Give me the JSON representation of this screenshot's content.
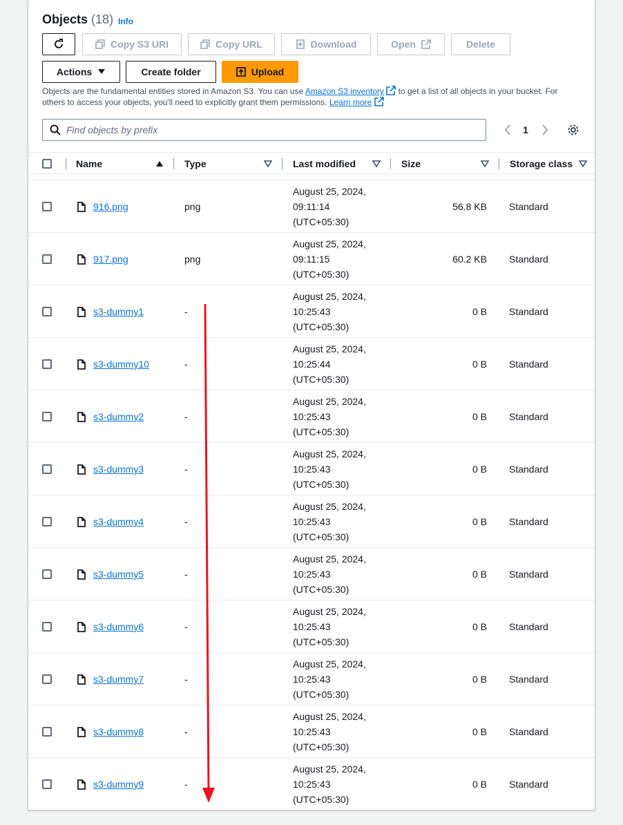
{
  "header": {
    "title": "Objects",
    "count": "(18)",
    "info": "Info"
  },
  "toolbar": {
    "refresh": "refresh",
    "copy_s3_uri": "Copy S3 URI",
    "copy_url": "Copy URL",
    "download": "Download",
    "open": "Open",
    "delete": "Delete",
    "actions": "Actions",
    "create_folder": "Create folder",
    "upload": "Upload"
  },
  "description": {
    "part1": "Objects are the fundamental entities stored in Amazon S3. You can use ",
    "link1": "Amazon S3 inventory",
    "part2": " to get a list of all objects in your bucket. For others to access your objects, you'll need to explicitly grant them permissions. ",
    "link2": "Learn more"
  },
  "search": {
    "placeholder": "Find objects by prefix"
  },
  "pagination": {
    "page": "1"
  },
  "table": {
    "columns": [
      "Name",
      "Type",
      "Last modified",
      "Size",
      "Storage class"
    ],
    "rows": [
      {
        "name": "916.png",
        "type": "png",
        "date": "August 25, 2024,",
        "time": "09:11:14",
        "tz": "(UTC+05:30)",
        "size": "56.8 KB",
        "class": "Standard"
      },
      {
        "name": "917.png",
        "type": "png",
        "date": "August 25, 2024,",
        "time": "09:11:15",
        "tz": "(UTC+05:30)",
        "size": "60.2 KB",
        "class": "Standard"
      },
      {
        "name": "s3-dummy1",
        "type": "-",
        "date": "August 25, 2024,",
        "time": "10:25:43",
        "tz": "(UTC+05:30)",
        "size": "0 B",
        "class": "Standard"
      },
      {
        "name": "s3-dummy10",
        "type": "-",
        "date": "August 25, 2024,",
        "time": "10:25:44",
        "tz": "(UTC+05:30)",
        "size": "0 B",
        "class": "Standard"
      },
      {
        "name": "s3-dummy2",
        "type": "-",
        "date": "August 25, 2024,",
        "time": "10:25:43",
        "tz": "(UTC+05:30)",
        "size": "0 B",
        "class": "Standard"
      },
      {
        "name": "s3-dummy3",
        "type": "-",
        "date": "August 25, 2024,",
        "time": "10:25:43",
        "tz": "(UTC+05:30)",
        "size": "0 B",
        "class": "Standard"
      },
      {
        "name": "s3-dummy4",
        "type": "-",
        "date": "August 25, 2024,",
        "time": "10:25:43",
        "tz": "(UTC+05:30)",
        "size": "0 B",
        "class": "Standard"
      },
      {
        "name": "s3-dummy5",
        "type": "-",
        "date": "August 25, 2024,",
        "time": "10:25:43",
        "tz": "(UTC+05:30)",
        "size": "0 B",
        "class": "Standard"
      },
      {
        "name": "s3-dummy6",
        "type": "-",
        "date": "August 25, 2024,",
        "time": "10:25:43",
        "tz": "(UTC+05:30)",
        "size": "0 B",
        "class": "Standard"
      },
      {
        "name": "s3-dummy7",
        "type": "-",
        "date": "August 25, 2024,",
        "time": "10:25:43",
        "tz": "(UTC+05:30)",
        "size": "0 B",
        "class": "Standard"
      },
      {
        "name": "s3-dummy8",
        "type": "-",
        "date": "August 25, 2024,",
        "time": "10:25:43",
        "tz": "(UTC+05:30)",
        "size": "0 B",
        "class": "Standard"
      },
      {
        "name": "s3-dummy9",
        "type": "-",
        "date": "August 25, 2024,",
        "time": "10:25:43",
        "tz": "(UTC+05:30)",
        "size": "0 B",
        "class": "Standard"
      }
    ]
  },
  "colors": {
    "accent": "#ff9900",
    "link": "#0972d3",
    "annotation": "#e8141e"
  }
}
